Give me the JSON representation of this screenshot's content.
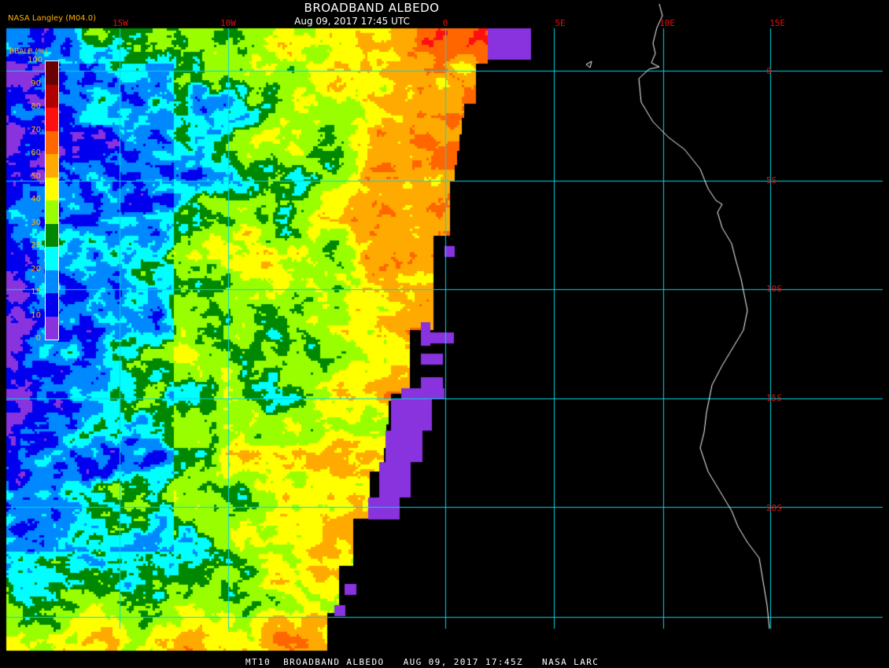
{
  "header": {
    "title": "BROADBAND ALBEDO",
    "subtitle": "Aug 09, 2017 17:45 UTC",
    "credit": "NASA Langley (M04.0)"
  },
  "footer": {
    "text": "MT10  BROADBAND ALBEDO   AUG 09, 2017 17:45Z   NASA LARC"
  },
  "colorbar": {
    "title": "BBALB (%)",
    "ticks": [
      "100",
      "90",
      "80",
      "70",
      "60",
      "50",
      "40",
      "30",
      "25",
      "20",
      "15",
      "10",
      "0"
    ],
    "colors": [
      "#6b0000",
      "#b00000",
      "#ff1010",
      "#ff6600",
      "#ffaa00",
      "#ffff00",
      "#99ff00",
      "#008800",
      "#00ffff",
      "#0088ff",
      "#0000ee",
      "#8833dd"
    ]
  },
  "grid": {
    "longitude_labels": [
      "15W",
      "10W",
      "0",
      "5E",
      "10E",
      "15E"
    ],
    "latitude_labels": [
      "0",
      "5S",
      "10S",
      "15S",
      "20S"
    ],
    "line_color": "#00d8e8"
  },
  "colors": {
    "background": "#000000",
    "label_red": "#e01010",
    "label_orange": "#ffb000",
    "no_data_purple": "#8833dd"
  }
}
